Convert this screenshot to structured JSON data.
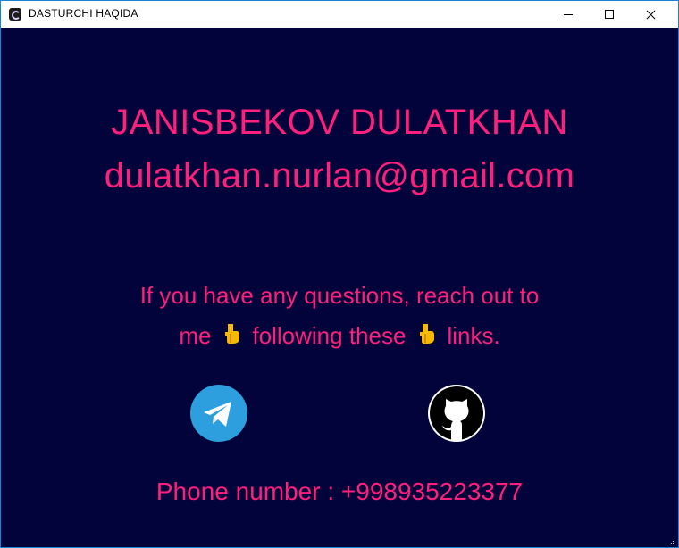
{
  "window": {
    "title": "DASTURCHI HAQIDA",
    "controls": [
      "minimize",
      "maximize",
      "close"
    ]
  },
  "profile": {
    "name": "JANISBEKOV DULATKHAN",
    "email": "dulatkhan.nurlan@gmail.com"
  },
  "message": {
    "line1": "If you have any questions, reach out to",
    "line2_part1": "me",
    "line2_part2": "following these",
    "line2_part3": "links.",
    "icon": "pointing-down-hand-icon"
  },
  "links": [
    {
      "name": "telegram",
      "icon": "telegram-icon",
      "color": "#2d9fde"
    },
    {
      "name": "github",
      "icon": "github-icon",
      "color": "#ffffff"
    }
  ],
  "contact": {
    "phone": "Phone number : +998935223377"
  },
  "colors": {
    "background": "#02033a",
    "text": "#ff1f7c",
    "accent_border": "#1883d7"
  }
}
